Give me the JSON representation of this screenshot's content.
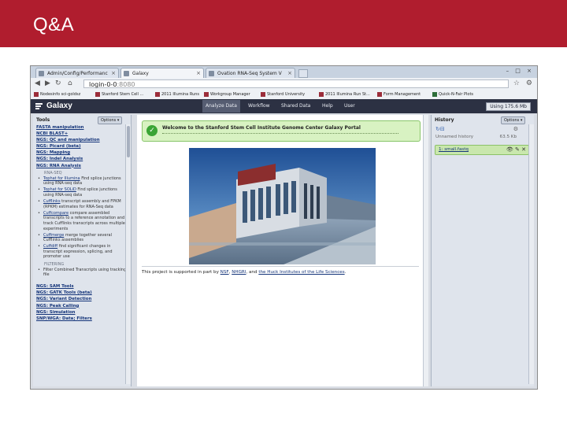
{
  "slide": {
    "title": "Q&A",
    "header_color": "#b01d2e"
  },
  "browser": {
    "tabs": [
      {
        "label": "Admin/Config/Performanc",
        "active": false
      },
      {
        "label": "Galaxy",
        "active": true
      },
      {
        "label": "Ovation RNA-Seq System V",
        "active": false
      }
    ],
    "url_host": "login-0-0",
    "url_port": ":8080",
    "bookmarks": [
      "Nodesinfo sci-goldsz",
      "Stanford Stem Cell ...",
      "2011 Illumina Runs",
      "Workgroup Manager",
      "Stanford University",
      "2011 Illumina Run St...",
      "Form Management",
      "Quick-N-Fair Plots"
    ]
  },
  "galaxy": {
    "logo": "Galaxy",
    "nav": [
      "Analyze Data",
      "Workflow",
      "Shared Data",
      "Help",
      "User"
    ],
    "usage": "Using 175.6 Mb",
    "masthead_color": "#2c3143"
  },
  "tools": {
    "title": "Tools",
    "options": "Options ▾",
    "sections_top": [
      "FASTA manipulation",
      "NCBI BLAST+",
      "NGS: QC and manipulation",
      "NGS: Picard (beta)",
      "NGS: Mapping",
      "NGS: Indel Analysis",
      "NGS: RNA Analysis"
    ],
    "rnaseq_header": "RNA-SEQ",
    "rnaseq_items": [
      {
        "link": "Tophat for Illumina",
        "desc": "Find splice junctions using RNA-seq data"
      },
      {
        "link": "Tophat for SOLiD",
        "desc": "Find splice junctions using RNA-seq data"
      },
      {
        "link": "Cufflinks",
        "desc": "transcript assembly and FPKM (RPKM) estimates for RNA-Seq data"
      },
      {
        "link": "Cuffcompare",
        "desc": "compare assembled transcripts to a reference annotation and track Cufflinks transcripts across multiple experiments"
      },
      {
        "link": "Cuffmerge",
        "desc": "merge together several Cufflinks assemblies"
      },
      {
        "link": "Cuffdiff",
        "desc": "find significant changes in transcript expression, splicing, and promoter use"
      }
    ],
    "filtering_header": "FILTERING",
    "filtering_items": [
      {
        "link": "",
        "desc": "Filter Combined Transcripts using tracking file"
      }
    ],
    "sections_bottom": [
      "NGS: SAM Tools",
      "NGS: GATK Tools (beta)",
      "NGS: Variant Detection",
      "NGS: Peak Calling",
      "NGS: Simulation",
      "SNP/WGA: Data; Filters"
    ]
  },
  "center": {
    "welcome": "Welcome to the Stanford Stem Cell Institute Genome Center Galaxy Portal",
    "support_prefix": "This project is supported in part by ",
    "support_nsf": "NSF",
    "support_sep1": ", ",
    "support_nhgri": "NHGRI",
    "support_sep2": ", and ",
    "support_huck": "the Huck Institutes of the Life Sciences",
    "support_end": "."
  },
  "history": {
    "title": "History",
    "options": "Options ▾",
    "name": "Unnamed history",
    "size": "63.5 Kb",
    "items": [
      {
        "label": "1: small.fastq"
      }
    ]
  }
}
